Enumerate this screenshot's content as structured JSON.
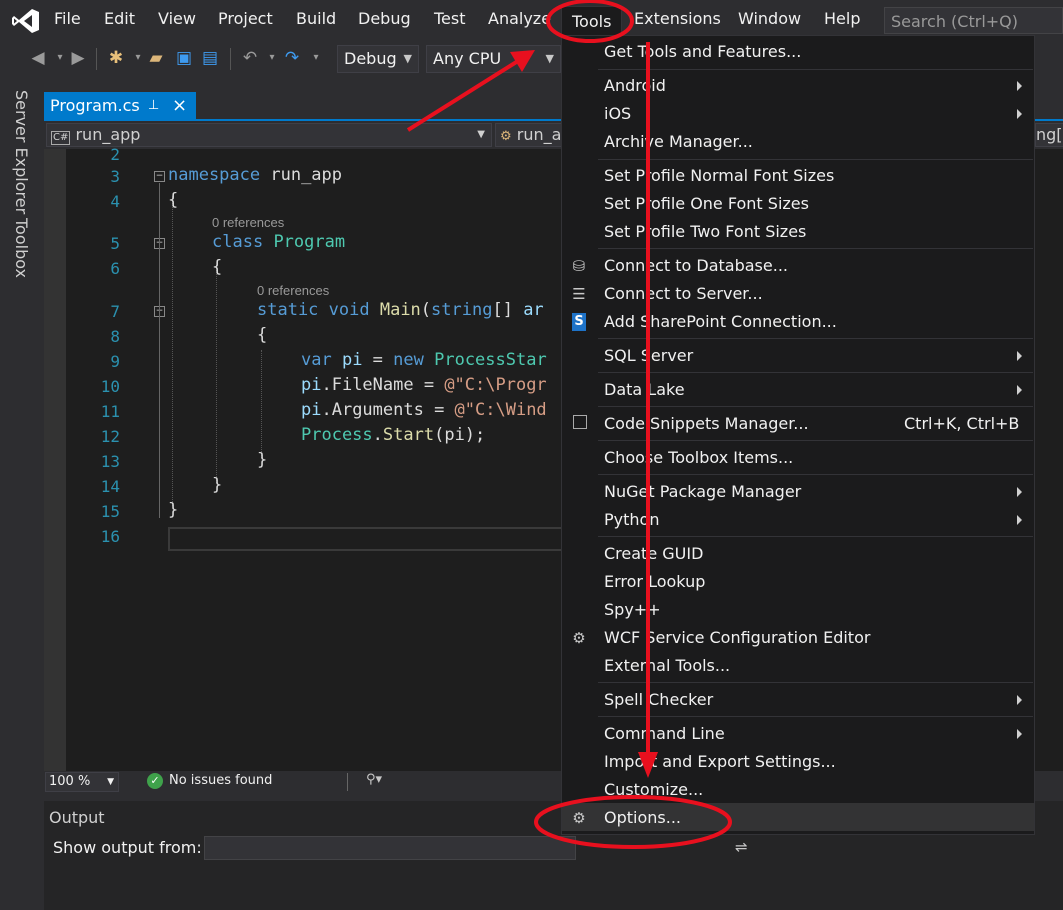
{
  "menubar": {
    "items": [
      "File",
      "Edit",
      "View",
      "Project",
      "Build",
      "Debug",
      "Test",
      "Analyze",
      "Tools",
      "Extensions",
      "Window",
      "Help"
    ],
    "search_placeholder": "Search (Ctrl+Q)"
  },
  "toolbar": {
    "config": "Debug",
    "platform": "Any CPU"
  },
  "left_rail": {
    "server_explorer": "Server Explorer",
    "toolbox": "Toolbox"
  },
  "tab": {
    "filename": "Program.cs",
    "pin": "⊥",
    "close": "×"
  },
  "navbar": {
    "project": "run_app",
    "class_partial": "run_a",
    "right_partial": "ng["
  },
  "editor": {
    "line_numbers": [
      "2",
      "3",
      "4",
      "5",
      "6",
      "7",
      "8",
      "9",
      "10",
      "11",
      "12",
      "13",
      "14",
      "15",
      "16"
    ],
    "references": [
      "0 references",
      "0 references"
    ],
    "code": {
      "l3_kw": "namespace",
      "l3_name": " run_app",
      "l4": "{",
      "l5_kw": "class",
      "l5_type": "Program",
      "l6": "{",
      "l7_kw": "static void",
      "l7_method": "Main",
      "l7_rest1": "(",
      "l7_kw2": "string",
      "l7_rest2": "[] ",
      "l7_arg": "ar",
      "l8": "{",
      "l9_kw": "var",
      "l9_var": " pi",
      "l9_eq": " = ",
      "l9_new": "new",
      "l9_type": " ProcessStar",
      "l10_var": "pi",
      "l10_prop": ".FileName = ",
      "l10_str": "@\"C:\\Progr",
      "l11_var": "pi",
      "l11_prop": ".Arguments = ",
      "l11_str": "@\"C:\\Wind",
      "l12_type": "Process",
      "l12_dot": ".",
      "l12_method": "Start",
      "l12_rest": "(pi);",
      "l13": "}",
      "l14": "}",
      "l15": "}"
    }
  },
  "statusbar": {
    "zoom": "100 %",
    "issues": "No issues found"
  },
  "output": {
    "title": "Output",
    "show_from": "Show output from:"
  },
  "tools_menu": {
    "items": [
      {
        "label": "Get Tools and Features..."
      },
      {
        "label": "Android",
        "submenu": true
      },
      {
        "label": "iOS",
        "submenu": true
      },
      {
        "label": "Archive Manager..."
      },
      {
        "label": "Set Profile Normal Font Sizes"
      },
      {
        "label": "Set Profile One Font Sizes"
      },
      {
        "label": "Set Profile Two Font Sizes"
      },
      {
        "label": "Connect to Database...",
        "icon": "database-icon"
      },
      {
        "label": "Connect to Server...",
        "icon": "server-icon"
      },
      {
        "label": "Add SharePoint Connection...",
        "icon": "sharepoint-icon"
      },
      {
        "label": "SQL Server",
        "submenu": true
      },
      {
        "label": "Data Lake",
        "submenu": true
      },
      {
        "label": "Code Snippets Manager...",
        "shortcut": "Ctrl+K, Ctrl+B",
        "icon": "snippet-icon"
      },
      {
        "label": "Choose Toolbox Items..."
      },
      {
        "label": "NuGet Package Manager",
        "submenu": true
      },
      {
        "label": "Python",
        "submenu": true
      },
      {
        "label": "Create GUID"
      },
      {
        "label": "Error Lookup"
      },
      {
        "label": "Spy++"
      },
      {
        "label": "WCF Service Configuration Editor",
        "icon": "wcf-gear-icon"
      },
      {
        "label": "External Tools..."
      },
      {
        "label": "Spell Checker",
        "submenu": true
      },
      {
        "label": "Command Line",
        "submenu": true
      },
      {
        "label": "Import and Export Settings..."
      },
      {
        "label": "Customize..."
      },
      {
        "label": "Options...",
        "icon": "gear-icon",
        "highlighted": true
      }
    ]
  },
  "colors": {
    "accent": "#007acc",
    "annotation": "#e8101e",
    "menu_bg": "#1b1b1c",
    "editor_bg": "#1e1e1e"
  }
}
